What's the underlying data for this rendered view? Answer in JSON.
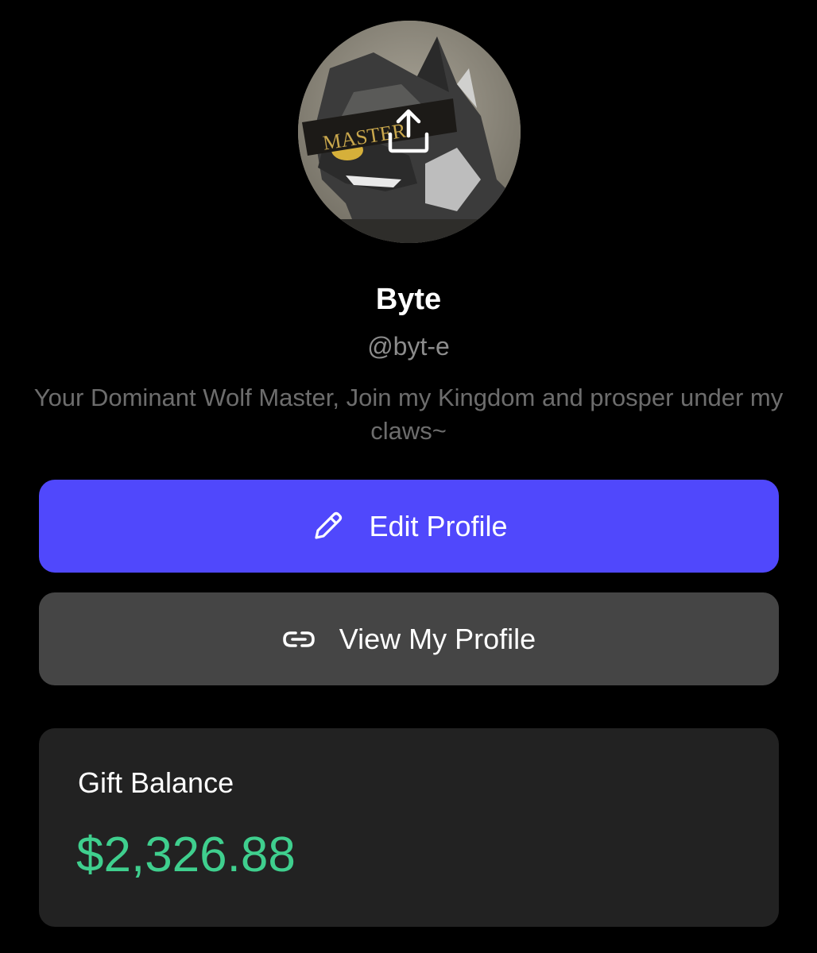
{
  "profile": {
    "avatar_banner_text": "MASTER",
    "display_name": "Byte",
    "handle": "@byt-e",
    "bio": "Your Dominant Wolf Master, Join my Kingdom and prosper under my claws~"
  },
  "actions": {
    "edit_label": "Edit Profile",
    "view_label": "View My Profile"
  },
  "gift_balance": {
    "label": "Gift Balance",
    "amount": "$2,326.88"
  },
  "icons": {
    "avatar_upload": "upload-icon",
    "edit": "pencil-icon",
    "view": "link-icon"
  },
  "colors": {
    "background": "#000000",
    "edit_button": "#5048fc",
    "view_button": "#454545",
    "card": "#222222",
    "balance_green": "#3fcf8e",
    "handle_gray": "#8c8c8c",
    "bio_gray": "#6d6d6d"
  }
}
